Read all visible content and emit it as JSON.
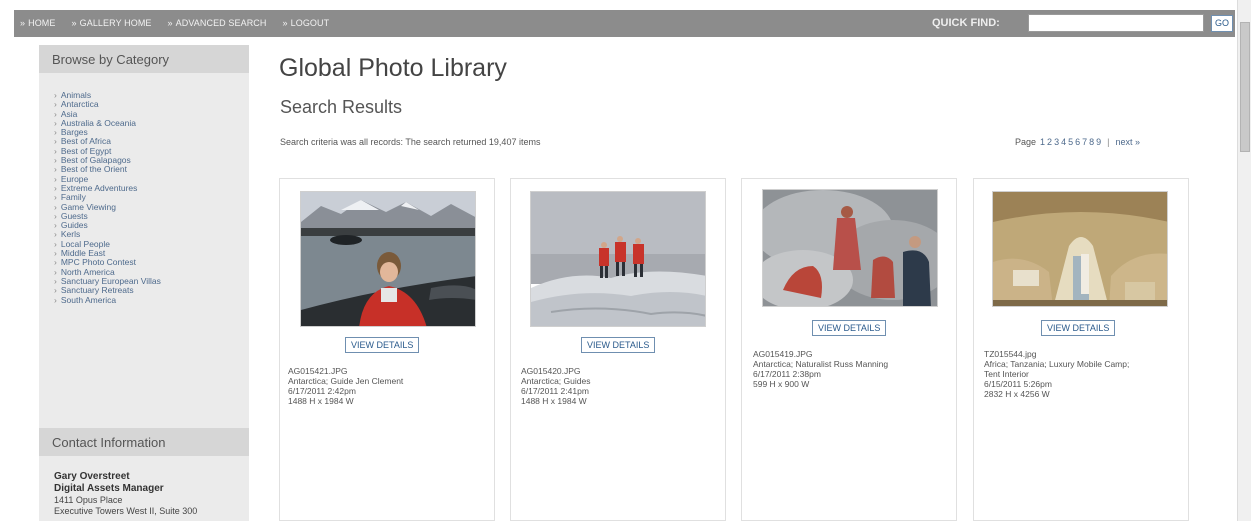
{
  "nav": {
    "items": [
      "HOME",
      "GALLERY HOME",
      "ADVANCED SEARCH",
      "LOGOUT"
    ],
    "arrow": "»",
    "quick_find_label": "QUICK FIND:",
    "quick_find_value": "",
    "go_label": "GO"
  },
  "sidebar": {
    "browse_title": "Browse by Category",
    "categories": [
      "Animals",
      "Antarctica",
      "Asia",
      "Australia & Oceania",
      "Barges",
      "Best of Africa",
      "Best of Egypt",
      "Best of Galapagos",
      "Best of the Orient",
      "Europe",
      "Extreme Adventures",
      "Family",
      "Game Viewing",
      "Guests",
      "Guides",
      "Kerls",
      "Local People",
      "Middle East",
      "MPC Photo Contest",
      "North America",
      "Sanctuary European Villas",
      "Sanctuary Retreats",
      "South America"
    ],
    "contact_title": "Contact Information",
    "contact": {
      "name": "Gary Overstreet",
      "title": "Digital Assets Manager",
      "address1": "1411 Opus Place",
      "address2": "Executive Towers West II, Suite 300"
    }
  },
  "main": {
    "page_title": "Global Photo Library",
    "results_title": "Search Results",
    "criteria": "Search criteria was all records:  The search returned 19,407 items",
    "pager": {
      "label": "Page",
      "pages": [
        "1",
        "2",
        "3",
        "4",
        "5",
        "6",
        "7",
        "8",
        "9"
      ],
      "separator": "|",
      "next": "next »"
    },
    "view_details_label": "VIEW DETAILS",
    "photos": [
      {
        "filename": "AG015421.JPG",
        "caption": "Antarctica; Guide Jen Clement",
        "date": "6/17/2011 2:42pm",
        "size": "1488 H x 1984 W"
      },
      {
        "filename": "AG015420.JPG",
        "caption": "Antarctica; Guides",
        "date": "6/17/2011 2:41pm",
        "size": "1488 H x 1984 W"
      },
      {
        "filename": "AG015419.JPG",
        "caption": "Antarctica; Naturalist Russ Manning",
        "date": "6/17/2011 2:38pm",
        "size": "599 H x 900 W"
      },
      {
        "filename": "TZ015544.jpg",
        "caption": "Africa; Tanzania; Luxury Mobile Camp;",
        "caption2": "Tent Interior",
        "date": "6/15/2011 5:26pm",
        "size": "2832 H x 4256 W"
      }
    ]
  }
}
